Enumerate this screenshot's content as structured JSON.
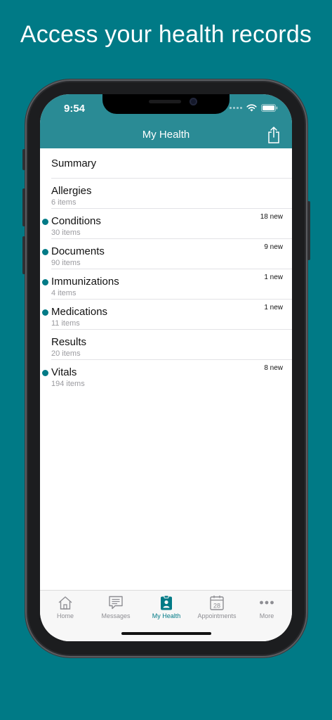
{
  "headline": "Access your health records",
  "colors": {
    "background": "#007a86",
    "nav_bar": "#2a8b95",
    "accent": "#007a86"
  },
  "status_bar": {
    "time": "9:54",
    "icons": [
      "signal-icon",
      "wifi-icon",
      "battery-icon"
    ]
  },
  "nav": {
    "title": "My Health",
    "action_icon": "share-icon"
  },
  "list": {
    "items": [
      {
        "label": "Summary",
        "sub": "",
        "badge": "",
        "unread": false
      },
      {
        "label": "Allergies",
        "sub": "6 items",
        "badge": "",
        "unread": false
      },
      {
        "label": "Conditions",
        "sub": "30 items",
        "badge": "18 new",
        "unread": true
      },
      {
        "label": "Documents",
        "sub": "90 items",
        "badge": "9 new",
        "unread": true
      },
      {
        "label": "Immunizations",
        "sub": "4 items",
        "badge": "1 new",
        "unread": true
      },
      {
        "label": "Medications",
        "sub": "11 items",
        "badge": "1 new",
        "unread": true
      },
      {
        "label": "Results",
        "sub": "20 items",
        "badge": "",
        "unread": false
      },
      {
        "label": "Vitals",
        "sub": "194 items",
        "badge": "8 new",
        "unread": true
      }
    ]
  },
  "tabs": {
    "items": [
      {
        "label": "Home",
        "icon": "home-icon",
        "active": false
      },
      {
        "label": "Messages",
        "icon": "messages-icon",
        "active": false
      },
      {
        "label": "My Health",
        "icon": "my-health-icon",
        "active": true
      },
      {
        "label": "Appointments",
        "icon": "calendar-icon",
        "active": false,
        "icon_text": "28"
      },
      {
        "label": "More",
        "icon": "more-icon",
        "active": false
      }
    ]
  }
}
